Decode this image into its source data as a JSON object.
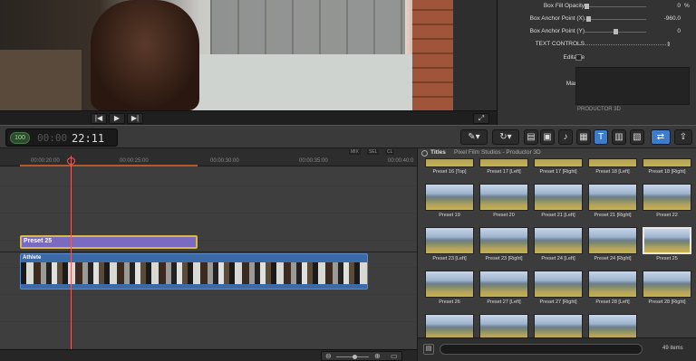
{
  "inspector": {
    "rows": [
      {
        "label": "Box Fill Opacity",
        "value": "0",
        "unit": "%"
      },
      {
        "label": "Box Anchor Point (X)",
        "value": "-960.0",
        "unit": ""
      },
      {
        "label": "Box Anchor Point (Y)",
        "value": "0",
        "unit": ""
      }
    ],
    "text_controls": "TEXT CONTROLS",
    "editable": "Editable",
    "marker": "Marker",
    "producer_text": "PRODUCTOR 3D"
  },
  "transport": {
    "prev": "|◀",
    "play": "▶",
    "next": "▶|",
    "fullscreen": "⤢"
  },
  "toolbar": {
    "timecode_circle": "100",
    "timecode_dim": "00:00",
    "timecode_value": "22:11",
    "tools": [
      "✎▾",
      "↻▾",
      "▤",
      "▣",
      "♪",
      "▦",
      "T",
      "▥",
      "▧",
      "⇄",
      "⇪"
    ]
  },
  "timeline": {
    "ruler_ticks": [
      "00:00:20:00",
      "00:00:25:00",
      "00:00:30:00",
      "00:00:35:00",
      "00:00:40:0"
    ],
    "modes": [
      "MIX",
      "SEL",
      "CL"
    ],
    "title_clip": "Preset 25",
    "video_clip": "Athlete"
  },
  "browser": {
    "title": "Titles",
    "breadcrumb": "Pixel Film Studios - Productor 3D",
    "items": [
      {
        "label": "Preset 16 [Top]",
        "partial": true
      },
      {
        "label": "Preset 17 [Left]",
        "partial": true
      },
      {
        "label": "Preset 17 [Right]",
        "partial": true
      },
      {
        "label": "Preset 18 [Left]",
        "partial": true
      },
      {
        "label": "Preset 18 [Right]",
        "partial": true
      },
      {
        "label": "Preset 19"
      },
      {
        "label": "Preset 20"
      },
      {
        "label": "Preset 21 [Left]"
      },
      {
        "label": "Preset 21 [Right]"
      },
      {
        "label": "Preset 22"
      },
      {
        "label": "Preset 23 [Left]"
      },
      {
        "label": "Preset 23 [Right]"
      },
      {
        "label": "Preset 24 [Left]"
      },
      {
        "label": "Preset 24 [Right]"
      },
      {
        "label": "Preset 25",
        "selected": true
      },
      {
        "label": "Preset 26"
      },
      {
        "label": "Preset 27 [Left]"
      },
      {
        "label": "Preset 27 [Right]"
      },
      {
        "label": "Preset 28 [Left]"
      },
      {
        "label": "Preset 28 [Right]"
      },
      {
        "label": ""
      },
      {
        "label": ""
      },
      {
        "label": ""
      },
      {
        "label": ""
      }
    ],
    "search_placeholder": "",
    "item_count": "49 items"
  },
  "zoom": {
    "out": "⊖",
    "in": "⊕",
    "extra": "▭"
  }
}
